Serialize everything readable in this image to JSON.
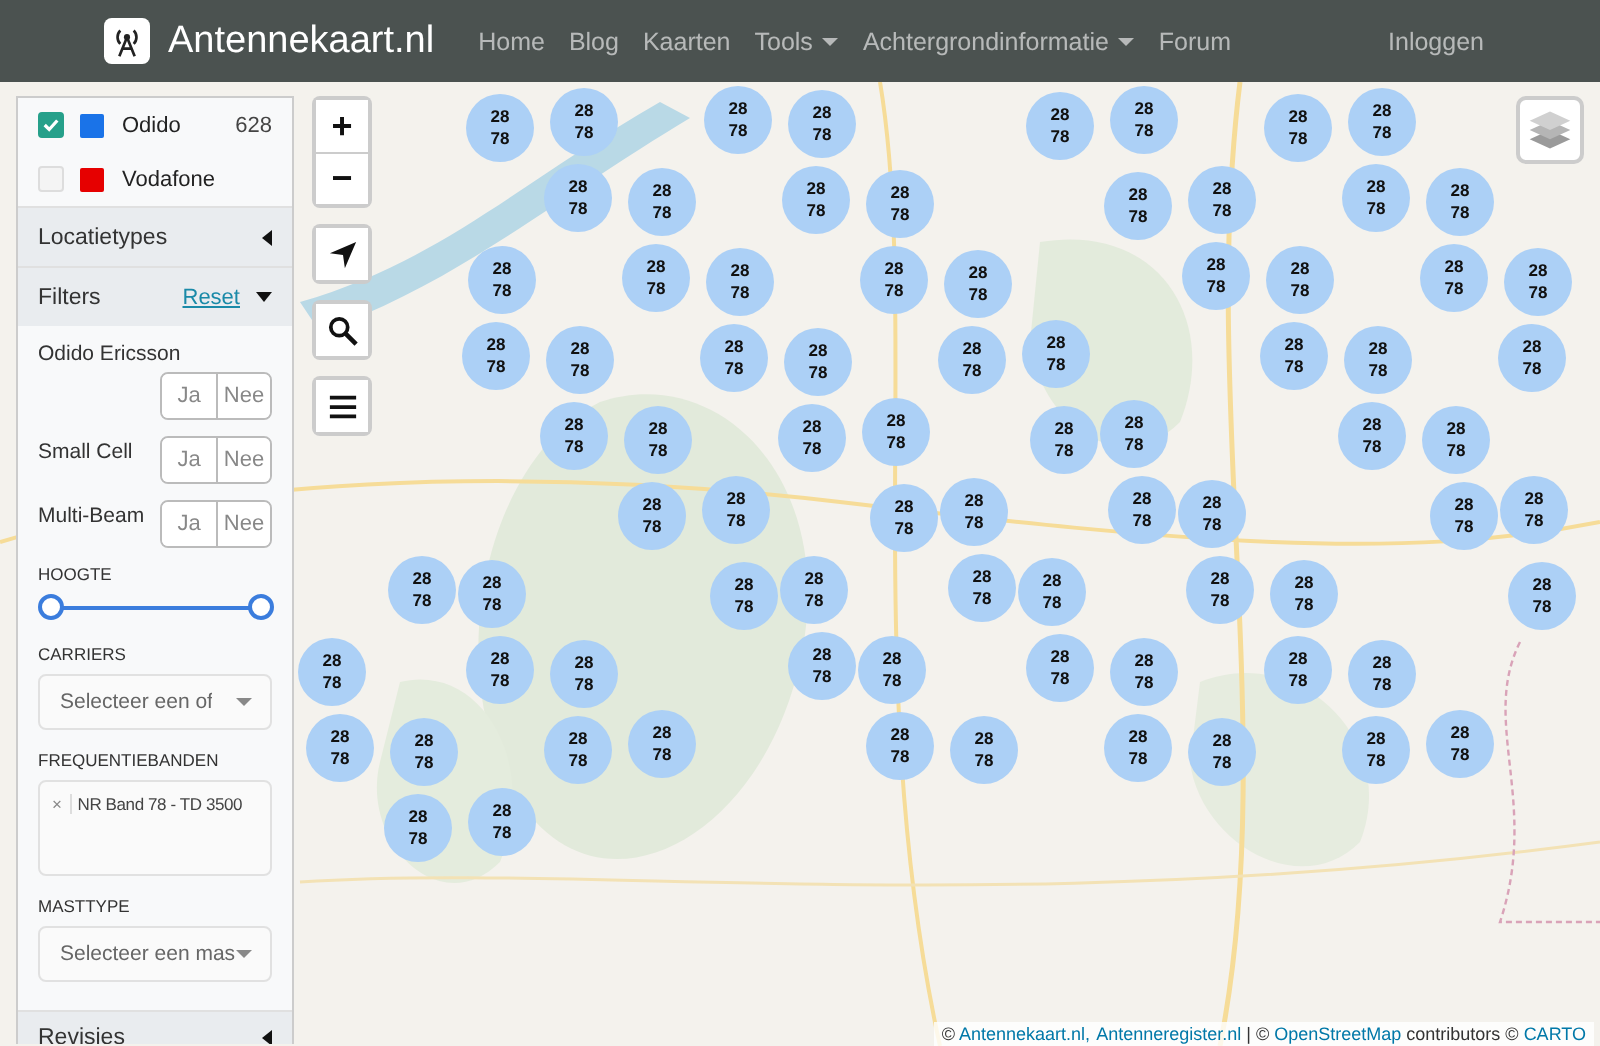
{
  "navbar": {
    "brand": "Antennekaart.nl",
    "items": [
      {
        "label": "Home",
        "dropdown": false
      },
      {
        "label": "Blog",
        "dropdown": false
      },
      {
        "label": "Kaarten",
        "dropdown": false
      },
      {
        "label": "Tools",
        "dropdown": true
      },
      {
        "label": "Achtergrondinformatie",
        "dropdown": true
      },
      {
        "label": "Forum",
        "dropdown": false
      }
    ],
    "login": "Inloggen"
  },
  "sidebar": {
    "operators": [
      {
        "name": "Odido",
        "checked": true,
        "color": "#1a73e8",
        "count": "628"
      },
      {
        "name": "Vodafone",
        "checked": false,
        "color": "#e60000"
      }
    ],
    "sections": [
      {
        "title": "Locatietypes",
        "expanded": false
      },
      {
        "title": "Filters",
        "expanded": true,
        "action": "Reset"
      }
    ],
    "toggles": [
      {
        "label": "Odido Ericsson",
        "yes": "Ja",
        "no": "Nee"
      },
      {
        "label": "Small Cell",
        "yes": "Ja",
        "no": "Nee"
      },
      {
        "label": "Multi-Beam",
        "yes": "Ja",
        "no": "Nee"
      }
    ],
    "height": {
      "label": "HOOGTE",
      "thumbs": [
        {
          "level": 0
        },
        {
          "level": 1
        }
      ]
    },
    "carriers": {
      "label": "CARRIERS",
      "placeholder": "Selecteer een of"
    },
    "bands": {
      "label": "FREQUENTIEBANDEN",
      "remove": "×",
      "tags": [
        "NR Band 78 - TD 3500"
      ]
    },
    "masttype": {
      "label": "MASTTYPE",
      "placeholder": "Selecteer een mas"
    },
    "footer_section": {
      "title": "Revisies",
      "expanded": false
    }
  },
  "map_controls": {
    "zoom_in": "+",
    "zoom_out": "−"
  },
  "markers": [
    {
      "lines": [
        "28",
        "78"
      ]
    },
    {
      "lines": [
        "28",
        "78"
      ]
    },
    {
      "lines": [
        "28",
        "78"
      ]
    },
    {
      "lines": [
        "28",
        "78"
      ]
    },
    {
      "lines": [
        "28",
        "78"
      ]
    },
    {
      "lines": [
        "28",
        "78"
      ]
    },
    {
      "lines": [
        "28",
        "78"
      ]
    },
    {
      "lines": [
        "28",
        "78"
      ]
    },
    {
      "lines": [
        "28",
        "78"
      ]
    },
    {
      "lines": [
        "28",
        "78"
      ]
    },
    {
      "lines": [
        "28",
        "78"
      ]
    },
    {
      "lines": [
        "28",
        "78"
      ]
    },
    {
      "lines": [
        "28",
        "78"
      ]
    },
    {
      "lines": [
        "28",
        "78"
      ]
    },
    {
      "lines": [
        "28",
        "78"
      ]
    },
    {
      "lines": [
        "28",
        "78"
      ]
    },
    {
      "lines": [
        "28",
        "78"
      ]
    },
    {
      "lines": [
        "28",
        "78"
      ]
    },
    {
      "lines": [
        "28",
        "78"
      ]
    },
    {
      "lines": [
        "28",
        "78"
      ]
    },
    {
      "lines": [
        "28",
        "78"
      ]
    },
    {
      "lines": [
        "28",
        "78"
      ]
    },
    {
      "lines": [
        "28",
        "78"
      ]
    },
    {
      "lines": [
        "28",
        "78"
      ]
    },
    {
      "lines": [
        "28",
        "78"
      ]
    },
    {
      "lines": [
        "28",
        "78"
      ]
    },
    {
      "lines": [
        "28",
        "78"
      ]
    },
    {
      "lines": [
        "28",
        "78"
      ]
    },
    {
      "lines": [
        "28",
        "78"
      ]
    },
    {
      "lines": [
        "28",
        "78"
      ]
    },
    {
      "lines": [
        "28",
        "78"
      ]
    },
    {
      "lines": [
        "28",
        "78"
      ]
    },
    {
      "lines": [
        "28",
        "78"
      ]
    },
    {
      "lines": [
        "28",
        "78"
      ]
    },
    {
      "lines": [
        "28",
        "78"
      ]
    },
    {
      "lines": [
        "28",
        "78"
      ]
    },
    {
      "lines": [
        "28",
        "78"
      ]
    },
    {
      "lines": [
        "28",
        "78"
      ]
    },
    {
      "lines": [
        "28",
        "78"
      ]
    },
    {
      "lines": [
        "28",
        "78"
      ]
    },
    {
      "lines": [
        "28",
        "78"
      ]
    },
    {
      "lines": [
        "28",
        "78"
      ]
    },
    {
      "lines": [
        "28",
        "78"
      ]
    },
    {
      "lines": [
        "28",
        "78"
      ]
    },
    {
      "lines": [
        "28",
        "78"
      ]
    },
    {
      "lines": [
        "28",
        "78"
      ]
    },
    {
      "lines": [
        "28",
        "78"
      ]
    },
    {
      "lines": [
        "28",
        "78"
      ]
    },
    {
      "lines": [
        "28",
        "78"
      ]
    },
    {
      "lines": [
        "28",
        "78"
      ]
    },
    {
      "lines": [
        "28",
        "78"
      ]
    },
    {
      "lines": [
        "28",
        "78"
      ]
    },
    {
      "lines": [
        "28",
        "78"
      ]
    },
    {
      "lines": [
        "28",
        "78"
      ]
    },
    {
      "lines": [
        "28",
        "78"
      ]
    },
    {
      "lines": [
        "28",
        "78"
      ]
    },
    {
      "lines": [
        "28",
        "78"
      ]
    },
    {
      "lines": [
        "28",
        "78"
      ]
    },
    {
      "lines": [
        "28",
        "78"
      ]
    },
    {
      "lines": [
        "28",
        "78"
      ]
    },
    {
      "lines": [
        "28",
        "78"
      ]
    },
    {
      "lines": [
        "28",
        "78"
      ]
    },
    {
      "lines": [
        "28",
        "78"
      ]
    },
    {
      "lines": [
        "28",
        "78"
      ]
    },
    {
      "lines": [
        "28",
        "78"
      ]
    },
    {
      "lines": [
        "28",
        "78"
      ]
    },
    {
      "lines": [
        "28",
        "78"
      ]
    },
    {
      "lines": [
        "28",
        "78"
      ]
    },
    {
      "lines": [
        "28",
        "78"
      ]
    },
    {
      "lines": [
        "28",
        "78"
      ]
    },
    {
      "lines": [
        "28",
        "78"
      ]
    },
    {
      "lines": [
        "28",
        "78"
      ]
    },
    {
      "lines": [
        "28",
        "78"
      ]
    },
    {
      "lines": [
        "28",
        "78"
      ]
    },
    {
      "lines": [
        "28",
        "78"
      ]
    },
    {
      "lines": [
        "28",
        "78"
      ]
    },
    {
      "lines": [
        "28",
        "78"
      ]
    },
    {
      "lines": [
        "28",
        "78"
      ]
    },
    {
      "lines": [
        "28",
        "78"
      ]
    },
    {
      "lines": [
        "28",
        "78"
      ]
    }
  ],
  "attribution": [
    {
      "text": "© ",
      "link": false
    },
    {
      "text": "Antennekaart.nl,",
      "link": true
    },
    {
      "text": "Antenneregister.nl",
      "link": true
    },
    {
      "text": " | © ",
      "link": false
    },
    {
      "text": "OpenStreetMap",
      "link": true
    },
    {
      "text": " contributors © ",
      "link": false
    },
    {
      "text": "CARTO",
      "link": true
    }
  ]
}
